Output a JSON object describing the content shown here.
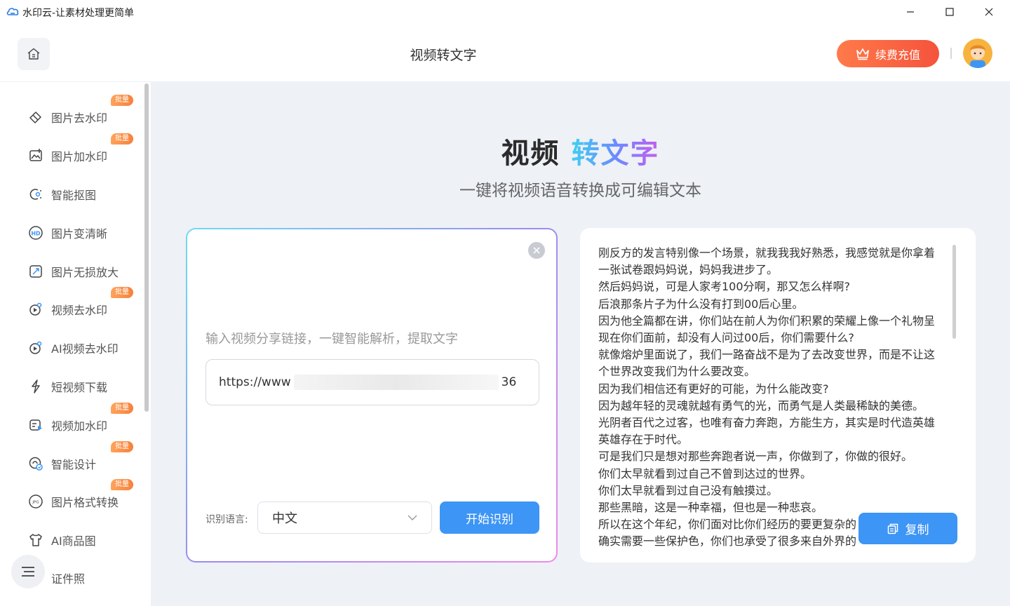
{
  "window": {
    "title": "水印云-让素材处理更简单",
    "controls": [
      "minimize",
      "maximize",
      "close"
    ]
  },
  "header": {
    "page_title": "视频转文字",
    "vip_label": "续费充值"
  },
  "sidebar": {
    "items": [
      {
        "label": "图片去水印",
        "badge": "批量",
        "icon": "eraser-icon"
      },
      {
        "label": "图片加水印",
        "badge": "批量",
        "icon": "image-add-icon"
      },
      {
        "label": "智能抠图",
        "badge": "",
        "icon": "cutout-icon"
      },
      {
        "label": "图片变清晰",
        "badge": "",
        "icon": "hd-icon"
      },
      {
        "label": "图片无损放大",
        "badge": "",
        "icon": "enlarge-icon"
      },
      {
        "label": "视频去水印",
        "badge": "批量",
        "icon": "video-erase-icon"
      },
      {
        "label": "AI视频去水印",
        "badge": "",
        "icon": "ai-video-icon"
      },
      {
        "label": "短视频下载",
        "badge": "",
        "icon": "download-icon"
      },
      {
        "label": "视频加水印",
        "badge": "批量",
        "icon": "video-add-icon"
      },
      {
        "label": "智能设计",
        "badge": "批量",
        "icon": "design-icon"
      },
      {
        "label": "图片格式转换",
        "badge": "批量",
        "icon": "format-icon"
      },
      {
        "label": "AI商品图",
        "badge": "",
        "icon": "shirt-icon"
      },
      {
        "label": "证件照",
        "badge": "",
        "icon": "id-photo-icon"
      }
    ]
  },
  "hero": {
    "title_part1": "视频",
    "title_part2": "转文字",
    "subtitle": "一键将视频语音转换成可编辑文本"
  },
  "input_panel": {
    "hint": "输入视频分享链接，一键智能解析，提取文字",
    "url_value": "https://www",
    "url_suffix": "36",
    "language_label": "识别语言:",
    "language_value": "中文",
    "start_label": "开始识别"
  },
  "output_panel": {
    "lines": [
      "刚反方的发言特别像一个场景，就我我我好熟悉，我感觉就是你拿着",
      "一张试卷跟妈妈说，妈妈我进步了。",
      "然后妈妈说，可是人家考100分啊，那又怎么样啊?",
      "后浪那条片子为什么没有打到00后心里。",
      "因为他全篇都在讲，你们站在前人为你们积累的荣耀上像一个礼物呈",
      "现在你们面前，却没有人问过00后，你们需要什么?",
      "就像熔炉里面说了，我们一路奋战不是为了去改变世界，而是不让这",
      "个世界改变我们为什么要改变。",
      "因为我们相信还有更好的可能，为什么能改变?",
      "因为越年轻的灵魂就越有勇气的光，而勇气是人类最稀缺的美德。",
      "光阴者百代之过客，也唯有奋力奔跑，方能生方，其实是时代造英雄",
      "英雄存在于时代。",
      "可是我们只是想对那些奔跑者说一声，你做到了，你做的很好。",
      "你们太早就看到过自己不曾到达过的世界。",
      "你们太早就看到过自己没有触摸过。",
      "那些黑暗，这是一种幸福，但也是一种悲哀。",
      "所以在这个年纪，你们面对比你们经历的要更复杂的",
      "确实需要一些保护色，你们也承受了很多来自外界的"
    ],
    "copy_label": "复制"
  },
  "colors": {
    "primary": "#3d95f5",
    "vip_start": "#ff7a4a",
    "vip_end": "#f5533c",
    "badge": "#f5813c",
    "background": "#eef1f6"
  }
}
